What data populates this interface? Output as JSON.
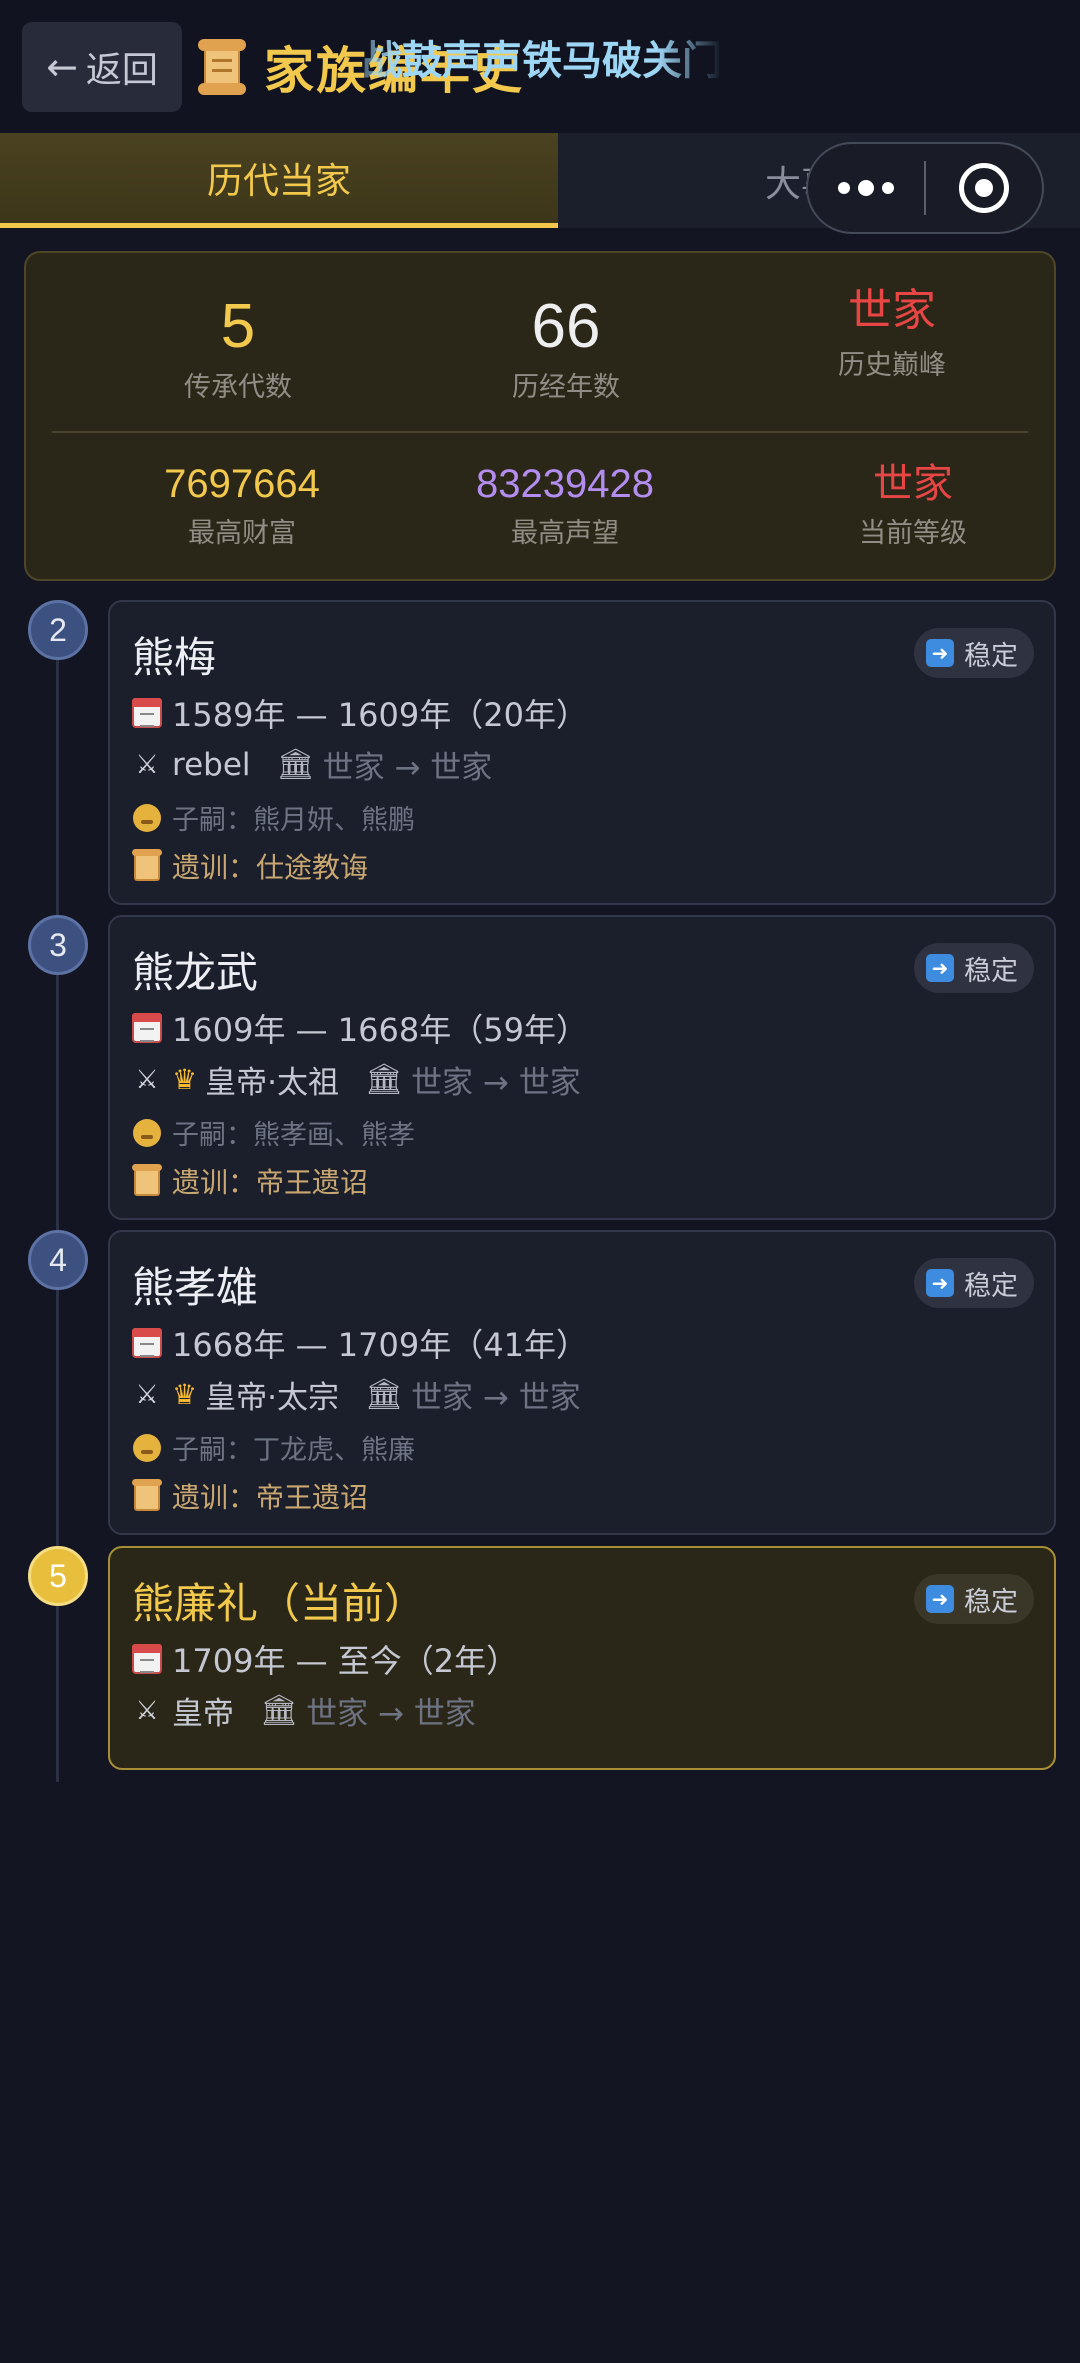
{
  "header": {
    "back_label": "返回",
    "back_arrow": "←",
    "title": "家族编年史",
    "marquee": "战鼓声声铁马破关门"
  },
  "tabs": [
    {
      "label": "历代当家",
      "active": true
    },
    {
      "label": "大事记",
      "active": false
    }
  ],
  "stats": {
    "generations": {
      "value": "5",
      "label": "传承代数"
    },
    "years": {
      "value": "66",
      "label": "历经年数"
    },
    "peak": {
      "value": "世家",
      "label": "历史巅峰"
    },
    "wealth": {
      "value": "7697664",
      "label": "最高财富"
    },
    "prestige": {
      "value": "83239428",
      "label": "最高声望"
    },
    "level": {
      "value": "世家",
      "label": "当前等级"
    }
  },
  "heads": [
    {
      "gen": "2",
      "name": "熊梅",
      "status": "稳定",
      "dates": "1589年 — 1609年（20年）",
      "title": "rebel",
      "level_change": "世家 → 世家",
      "heirs": "子嗣：熊月妍、熊鹏",
      "legacy": "遗训：仕途教诲",
      "crown": false
    },
    {
      "gen": "3",
      "name": "熊龙武",
      "status": "稳定",
      "dates": "1609年 — 1668年（59年）",
      "title": "皇帝·太祖",
      "level_change": "世家 → 世家",
      "heirs": "子嗣：熊孝画、熊孝",
      "legacy": "遗训：帝王遗诏",
      "crown": true
    },
    {
      "gen": "4",
      "name": "熊孝雄",
      "status": "稳定",
      "dates": "1668年 — 1709年（41年）",
      "title": "皇帝·太宗",
      "level_change": "世家 → 世家",
      "heirs": "子嗣：丁龙虎、熊廉",
      "legacy": "遗训：帝王遗诏",
      "crown": true
    },
    {
      "gen": "5",
      "name": "熊廉礼（当前）",
      "status": "稳定",
      "dates": "1709年 — 至今（2年）",
      "title": "皇帝",
      "level_change": "世家 → 世家",
      "crown": false
    }
  ],
  "icons": {
    "badge": "right-arrow-icon",
    "dates": "calendar-icon",
    "title": "crossed-swords-icon",
    "level": "temple-icon",
    "heirs": "baby-icon",
    "legacy": "scroll-icon"
  },
  "colors": {
    "accent_gold": "#f2c94c",
    "accent_red": "#e84545",
    "accent_purple": "#b38df0",
    "background": "#131622"
  }
}
